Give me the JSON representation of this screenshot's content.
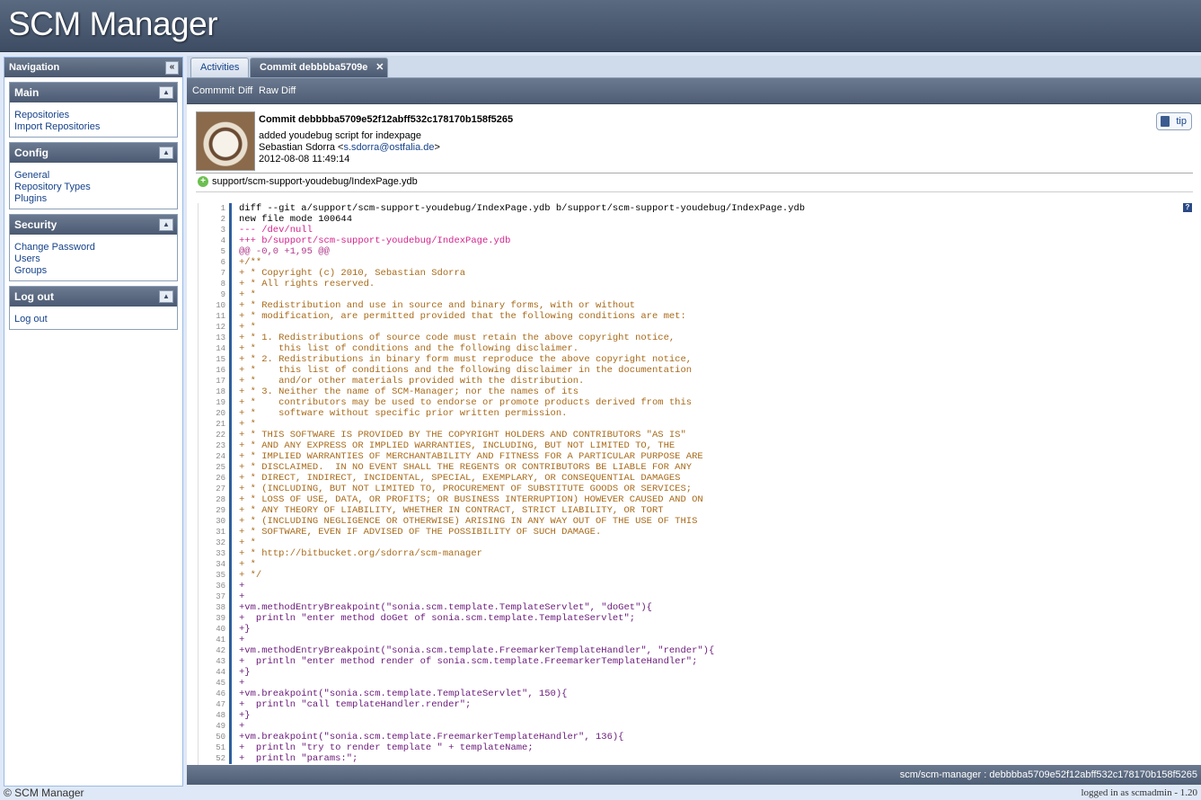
{
  "app": {
    "title": "SCM Manager"
  },
  "nav": {
    "title": "Navigation",
    "panels": [
      {
        "title": "Main",
        "items": [
          "Repositories",
          "Import Repositories"
        ]
      },
      {
        "title": "Config",
        "items": [
          "General",
          "Repository Types",
          "Plugins"
        ]
      },
      {
        "title": "Security",
        "items": [
          "Change Password",
          "Users",
          "Groups"
        ]
      },
      {
        "title": "Log out",
        "items": [
          "Log out"
        ]
      }
    ]
  },
  "tabs": [
    {
      "label": "Activities",
      "active": false
    },
    {
      "label": "Commit debbbba5709e",
      "active": true
    }
  ],
  "toolbar": {
    "commit": "Commmit",
    "diff": "Diff",
    "raw_diff": "Raw Diff"
  },
  "commit": {
    "title": "Commit debbbba5709e52f12abff532c178170b158f5265",
    "message": "added youdebug script for indexpage",
    "author_name": "Sebastian Sdorra <",
    "author_email": "s.sdorra@ostfalia.de",
    "author_close": ">",
    "date": "2012-08-08 11:49:14",
    "tip": "tip"
  },
  "file": {
    "path": "support/scm-support-youdebug/IndexPage.ydb"
  },
  "diff_lines": [
    {
      "n": "1",
      "t": "diff --git a/support/scm-support-youdebug/IndexPage.ydb b/support/scm-support-youdebug/IndexPage.ydb",
      "k": "meta"
    },
    {
      "n": "2",
      "t": "new file mode 100644",
      "k": "meta"
    },
    {
      "n": "3",
      "t": "--- /dev/null",
      "k": "removed"
    },
    {
      "n": "4",
      "t": "+++ b/support/scm-support-youdebug/IndexPage.ydb",
      "k": "added-path"
    },
    {
      "n": "5",
      "t": "@@ -0,0 +1,95 @@",
      "k": "hunk"
    },
    {
      "n": "6",
      "t": "+/**",
      "k": "comment"
    },
    {
      "n": "7",
      "t": "+ * Copyright (c) 2010, Sebastian Sdorra",
      "k": "comment"
    },
    {
      "n": "8",
      "t": "+ * All rights reserved.",
      "k": "comment"
    },
    {
      "n": "9",
      "t": "+ *",
      "k": "comment"
    },
    {
      "n": "10",
      "t": "+ * Redistribution and use in source and binary forms, with or without",
      "k": "comment"
    },
    {
      "n": "11",
      "t": "+ * modification, are permitted provided that the following conditions are met:",
      "k": "comment"
    },
    {
      "n": "12",
      "t": "+ *",
      "k": "comment"
    },
    {
      "n": "13",
      "t": "+ * 1. Redistributions of source code must retain the above copyright notice,",
      "k": "comment"
    },
    {
      "n": "14",
      "t": "+ *    this list of conditions and the following disclaimer.",
      "k": "comment"
    },
    {
      "n": "15",
      "t": "+ * 2. Redistributions in binary form must reproduce the above copyright notice,",
      "k": "comment"
    },
    {
      "n": "16",
      "t": "+ *    this list of conditions and the following disclaimer in the documentation",
      "k": "comment"
    },
    {
      "n": "17",
      "t": "+ *    and/or other materials provided with the distribution.",
      "k": "comment"
    },
    {
      "n": "18",
      "t": "+ * 3. Neither the name of SCM-Manager; nor the names of its",
      "k": "comment"
    },
    {
      "n": "19",
      "t": "+ *    contributors may be used to endorse or promote products derived from this",
      "k": "comment"
    },
    {
      "n": "20",
      "t": "+ *    software without specific prior written permission.",
      "k": "comment"
    },
    {
      "n": "21",
      "t": "+ *",
      "k": "comment"
    },
    {
      "n": "22",
      "t": "+ * THIS SOFTWARE IS PROVIDED BY THE COPYRIGHT HOLDERS AND CONTRIBUTORS \"AS IS\"",
      "k": "comment"
    },
    {
      "n": "23",
      "t": "+ * AND ANY EXPRESS OR IMPLIED WARRANTIES, INCLUDING, BUT NOT LIMITED TO, THE",
      "k": "comment"
    },
    {
      "n": "24",
      "t": "+ * IMPLIED WARRANTIES OF MERCHANTABILITY AND FITNESS FOR A PARTICULAR PURPOSE ARE",
      "k": "comment"
    },
    {
      "n": "25",
      "t": "+ * DISCLAIMED.  IN NO EVENT SHALL THE REGENTS OR CONTRIBUTORS BE LIABLE FOR ANY",
      "k": "comment"
    },
    {
      "n": "26",
      "t": "+ * DIRECT, INDIRECT, INCIDENTAL, SPECIAL, EXEMPLARY, OR CONSEQUENTIAL DAMAGES",
      "k": "comment"
    },
    {
      "n": "27",
      "t": "+ * (INCLUDING, BUT NOT LIMITED TO, PROCUREMENT OF SUBSTITUTE GOODS OR SERVICES;",
      "k": "comment"
    },
    {
      "n": "28",
      "t": "+ * LOSS OF USE, DATA, OR PROFITS; OR BUSINESS INTERRUPTION) HOWEVER CAUSED AND ON",
      "k": "comment"
    },
    {
      "n": "29",
      "t": "+ * ANY THEORY OF LIABILITY, WHETHER IN CONTRACT, STRICT LIABILITY, OR TORT",
      "k": "comment"
    },
    {
      "n": "30",
      "t": "+ * (INCLUDING NEGLIGENCE OR OTHERWISE) ARISING IN ANY WAY OUT OF THE USE OF THIS",
      "k": "comment"
    },
    {
      "n": "31",
      "t": "+ * SOFTWARE, EVEN IF ADVISED OF THE POSSIBILITY OF SUCH DAMAGE.",
      "k": "comment"
    },
    {
      "n": "32",
      "t": "+ *",
      "k": "comment"
    },
    {
      "n": "33",
      "t": "+ * http://bitbucket.org/sdorra/scm-manager",
      "k": "comment"
    },
    {
      "n": "34",
      "t": "+ *",
      "k": "comment"
    },
    {
      "n": "35",
      "t": "+ */",
      "k": "comment"
    },
    {
      "n": "36",
      "t": "+",
      "k": "code"
    },
    {
      "n": "37",
      "t": "+",
      "k": "code"
    },
    {
      "n": "38",
      "t": "+vm.methodEntryBreakpoint(\"sonia.scm.template.TemplateServlet\", \"doGet\"){",
      "k": "code"
    },
    {
      "n": "39",
      "t": "+  println \"enter method doGet of sonia.scm.template.TemplateServlet\";",
      "k": "code"
    },
    {
      "n": "40",
      "t": "+}",
      "k": "code"
    },
    {
      "n": "41",
      "t": "+",
      "k": "code"
    },
    {
      "n": "42",
      "t": "+vm.methodEntryBreakpoint(\"sonia.scm.template.FreemarkerTemplateHandler\", \"render\"){",
      "k": "code"
    },
    {
      "n": "43",
      "t": "+  println \"enter method render of sonia.scm.template.FreemarkerTemplateHandler\";",
      "k": "code"
    },
    {
      "n": "44",
      "t": "+}",
      "k": "code"
    },
    {
      "n": "45",
      "t": "+",
      "k": "code"
    },
    {
      "n": "46",
      "t": "+vm.breakpoint(\"sonia.scm.template.TemplateServlet\", 150){",
      "k": "code"
    },
    {
      "n": "47",
      "t": "+  println \"call templateHandler.render\";",
      "k": "code"
    },
    {
      "n": "48",
      "t": "+}",
      "k": "code"
    },
    {
      "n": "49",
      "t": "+",
      "k": "code"
    },
    {
      "n": "50",
      "t": "+vm.breakpoint(\"sonia.scm.template.FreemarkerTemplateHandler\", 136){",
      "k": "code"
    },
    {
      "n": "51",
      "t": "+  println \"try to render template \" + templateName;",
      "k": "code"
    },
    {
      "n": "52",
      "t": "+  println \"params:\";",
      "k": "code"
    }
  ],
  "status": {
    "text": "scm/scm-manager : debbbba5709e52f12abff532c178170b158f5265"
  },
  "footer": {
    "copyright": "© SCM Manager",
    "login_prefix": "logged in as",
    "user": "scmadmin",
    "version": "- 1.20"
  }
}
